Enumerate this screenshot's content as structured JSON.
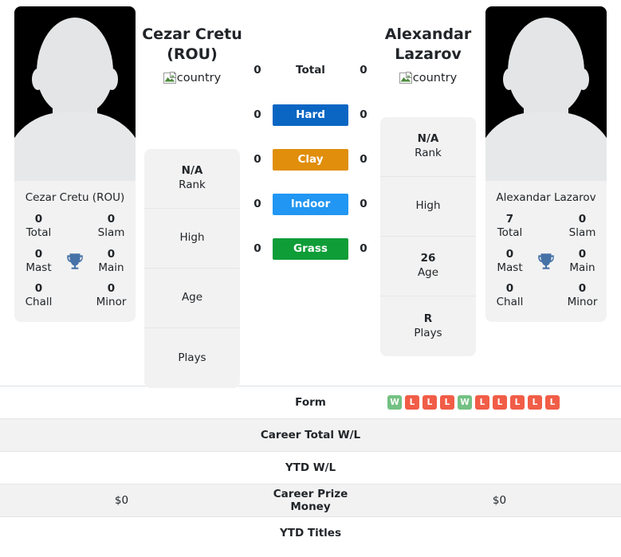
{
  "players": {
    "left": {
      "display_name": "Cezar Cretu (ROU)",
      "header_name_line1": "Cezar Cretu",
      "header_name_line2": "(ROU)",
      "flag_alt": "country",
      "card_name": "Cezar Cretu (ROU)",
      "titles": {
        "total_val": "0",
        "total_lbl": "Total",
        "slam_val": "0",
        "slam_lbl": "Slam",
        "mast_val": "0",
        "mast_lbl": "Mast",
        "main_val": "0",
        "main_lbl": "Main",
        "chall_val": "0",
        "chall_lbl": "Chall",
        "minor_val": "0",
        "minor_lbl": "Minor"
      },
      "ranking": [
        {
          "value": "N/A",
          "label": "Rank"
        },
        {
          "value": "",
          "label": "High"
        },
        {
          "value": "",
          "label": "Age"
        },
        {
          "value": "",
          "label": "Plays"
        }
      ],
      "surface_values": {
        "total": "0",
        "hard": "0",
        "clay": "0",
        "indoor": "0",
        "grass": "0"
      }
    },
    "right": {
      "display_name": "Alexandar Lazarov",
      "header_name_line1": "Alexandar",
      "header_name_line2": "Lazarov",
      "flag_alt": "country",
      "card_name": "Alexandar Lazarov",
      "titles": {
        "total_val": "7",
        "total_lbl": "Total",
        "slam_val": "0",
        "slam_lbl": "Slam",
        "mast_val": "0",
        "mast_lbl": "Mast",
        "main_val": "0",
        "main_lbl": "Main",
        "chall_val": "0",
        "chall_lbl": "Chall",
        "minor_val": "0",
        "minor_lbl": "Minor"
      },
      "ranking": [
        {
          "value": "N/A",
          "label": "Rank"
        },
        {
          "value": "",
          "label": "High"
        },
        {
          "value": "26",
          "label": "Age"
        },
        {
          "value": "R",
          "label": "Plays"
        }
      ],
      "surface_values": {
        "total": "0",
        "hard": "0",
        "clay": "0",
        "indoor": "0",
        "grass": "0"
      }
    }
  },
  "surfaces": {
    "total_label": "Total",
    "hard_label": "Hard",
    "clay_label": "Clay",
    "indoor_label": "Indoor",
    "grass_label": "Grass",
    "colors": {
      "hard": "#0b66c3",
      "clay": "#e08e0b",
      "indoor": "#2196f3",
      "grass": "#0f9d38"
    }
  },
  "icons": {
    "trophy": "trophy-icon",
    "broken_image": "broken-image-icon",
    "avatar": "player-avatar-silhouette"
  },
  "table": {
    "rows": [
      {
        "label": "Form",
        "left": "",
        "right": "",
        "right_badges": [
          "W",
          "L",
          "L",
          "L",
          "W",
          "L",
          "L",
          "L",
          "L",
          "L"
        ],
        "striped": false
      },
      {
        "label": "Career Total W/L",
        "left": "",
        "right": "",
        "striped": true
      },
      {
        "label": "YTD W/L",
        "left": "",
        "right": "",
        "striped": false
      },
      {
        "label": "Career Prize Money",
        "left": "$0",
        "right": "$0",
        "striped": true
      },
      {
        "label": "YTD Titles",
        "left": "",
        "right": "",
        "striped": false
      }
    ],
    "badge_colors": {
      "W": "#73c183",
      "L": "#f15d47"
    }
  }
}
